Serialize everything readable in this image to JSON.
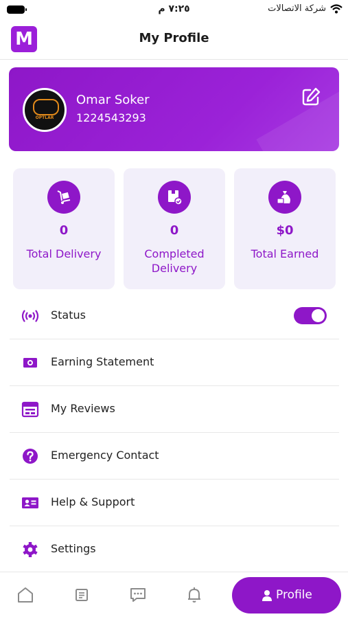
{
  "status_bar": {
    "carrier": "شركة الاتصالات",
    "time": "٧:٢٥ م"
  },
  "header": {
    "logo_letter": "M",
    "title": "My Profile"
  },
  "profile": {
    "name": "Omar Soker",
    "phone": "1224543293",
    "avatar_text": "OPTLAR"
  },
  "stats": [
    {
      "value": "0",
      "label": "Total Delivery",
      "icon": "delivery-cart-icon"
    },
    {
      "value": "0",
      "label": "Completed Delivery",
      "icon": "completed-box-icon"
    },
    {
      "value": "$0",
      "label": "Total Earned",
      "icon": "money-bag-icon"
    }
  ],
  "menu": [
    {
      "label": "Status",
      "icon": "broadcast-icon",
      "toggle_on": true
    },
    {
      "label": "Earning Statement",
      "icon": "cash-icon"
    },
    {
      "label": "My Reviews",
      "icon": "reviews-icon"
    },
    {
      "label": "Emergency Contact",
      "icon": "help-circle-icon"
    },
    {
      "label": "Help & Support",
      "icon": "contact-card-icon"
    },
    {
      "label": "Settings",
      "icon": "gear-icon"
    }
  ],
  "bottom_nav": {
    "profile_label": "Profile"
  },
  "colors": {
    "accent": "#8e17c8",
    "stat_bg": "#f2effa"
  }
}
